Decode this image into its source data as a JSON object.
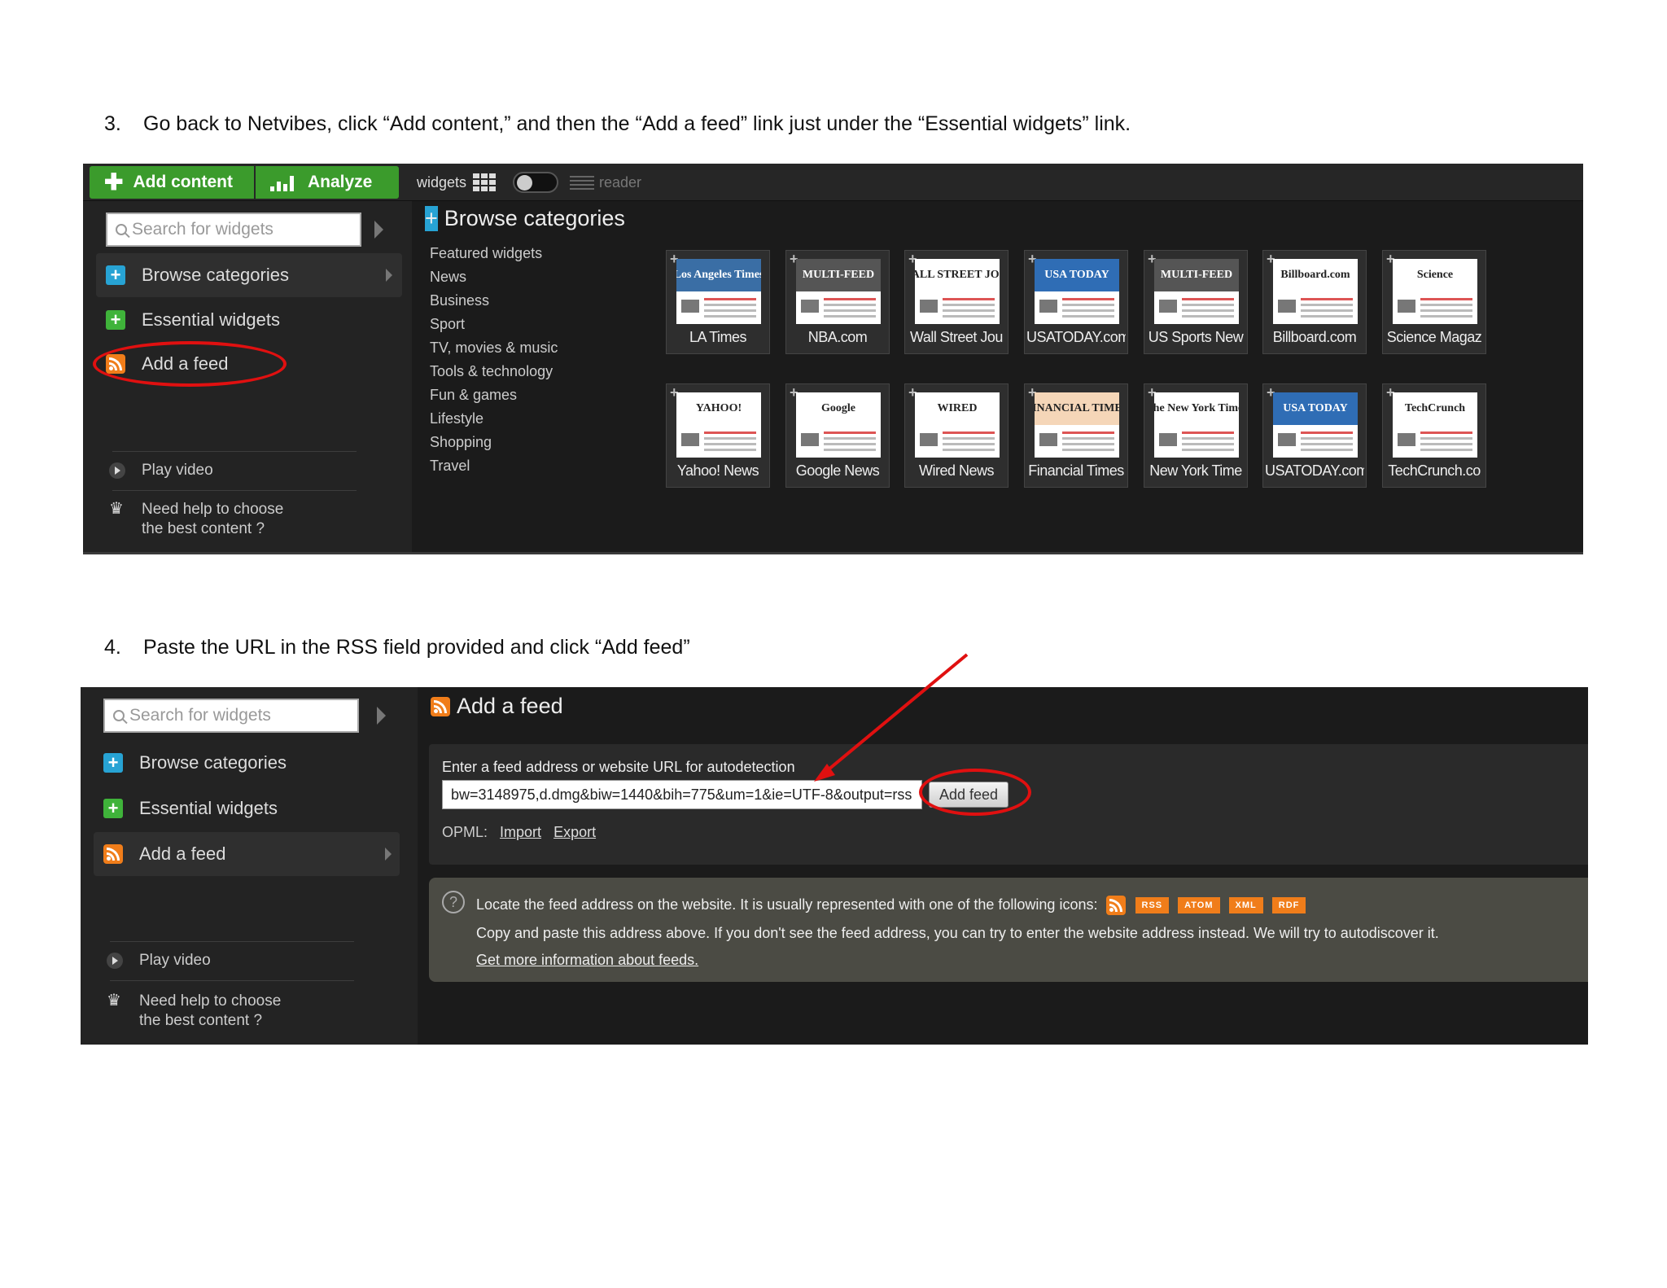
{
  "steps": [
    {
      "number": "3.",
      "text": "Go back to Netvibes, click “Add content,” and then the “Add a feed” link just under the “Essential widgets” link."
    },
    {
      "number": "4.",
      "text": "Paste the URL in the RSS field provided and click “Add feed”"
    }
  ],
  "panel1": {
    "tabs": {
      "add_content": "Add content",
      "analyze": "Analyze"
    },
    "toggle": {
      "widgets": "widgets",
      "reader": "reader"
    },
    "search_placeholder": "Search for widgets",
    "nav": [
      "Browse categories",
      "Essential widgets",
      "Add a feed"
    ],
    "help": {
      "play": "Play video",
      "need_help_1": "Need help to choose",
      "need_help_2": "the best content ?"
    },
    "section_title": "Browse categories",
    "categories": [
      "Featured widgets",
      "News",
      "Business",
      "Sport",
      "TV, movies & music",
      "Tools & technology",
      "Fun & games",
      "Lifestyle",
      "Shopping",
      "Travel"
    ],
    "tiles": [
      {
        "brand": "Los Angeles Times",
        "name": "LA Times",
        "color": "#3a6ea5"
      },
      {
        "brand": "MULTI-FEED",
        "name": "NBA.com",
        "color": "#555555"
      },
      {
        "brand": "THE WALL STREET JOURNAL",
        "name": "Wall Street Jou",
        "color": "#ffffff"
      },
      {
        "brand": "USA TODAY",
        "name": "USATODAY.com",
        "color": "#2f6db5"
      },
      {
        "brand": "MULTI-FEED",
        "name": "US Sports New",
        "color": "#555555"
      },
      {
        "brand": "Billboard.com",
        "name": "Billboard.com",
        "color": "#ffffff"
      },
      {
        "brand": "Science",
        "name": "Science Magaz",
        "color": "#ffffff"
      },
      {
        "brand": "YAHOO!",
        "name": "Yahoo! News",
        "color": "#ffffff"
      },
      {
        "brand": "Google",
        "name": "Google News",
        "color": "#ffffff"
      },
      {
        "brand": "WIRED",
        "name": "Wired News",
        "color": "#ffffff"
      },
      {
        "brand": "FINANCIAL TIMES",
        "name": "Financial Times",
        "color": "#f5d6b8"
      },
      {
        "brand": "The New York Times",
        "name": "New York Time",
        "color": "#ffffff"
      },
      {
        "brand": "USA TODAY",
        "name": "USATODAY.com",
        "color": "#2f6db5"
      },
      {
        "brand": "TechCrunch",
        "name": "TechCrunch.co",
        "color": "#ffffff"
      }
    ]
  },
  "panel2": {
    "search_placeholder": "Search for widgets",
    "nav": [
      "Browse categories",
      "Essential widgets",
      "Add a feed"
    ],
    "help": {
      "play": "Play video",
      "need_help_1": "Need help to choose",
      "need_help_2": "the best content ?"
    },
    "section_title": "Add a feed",
    "form_label": "Enter a feed address or website URL for autodetection",
    "url_value": "bw=3148975,d.dmg&biw=1440&bih=775&um=1&ie=UTF-8&output=rss",
    "add_feed_button": "Add feed",
    "opml_label": "OPML:",
    "import": "Import",
    "export": "Export",
    "info_line1": "Locate the feed address on the website. It is usually represented with one of the following icons:",
    "badges": [
      "RSS",
      "ATOM",
      "XML",
      "RDF"
    ],
    "info_line2": "Copy and paste this address above. If you don't see the feed address, you can try to enter the website address instead. We will try to autodiscover it.",
    "info_link": "Get more information about feeds."
  },
  "colors": {
    "accent_green": "#3b9b2c",
    "highlight_red": "#e01010",
    "rss_orange": "#f07d1a"
  }
}
